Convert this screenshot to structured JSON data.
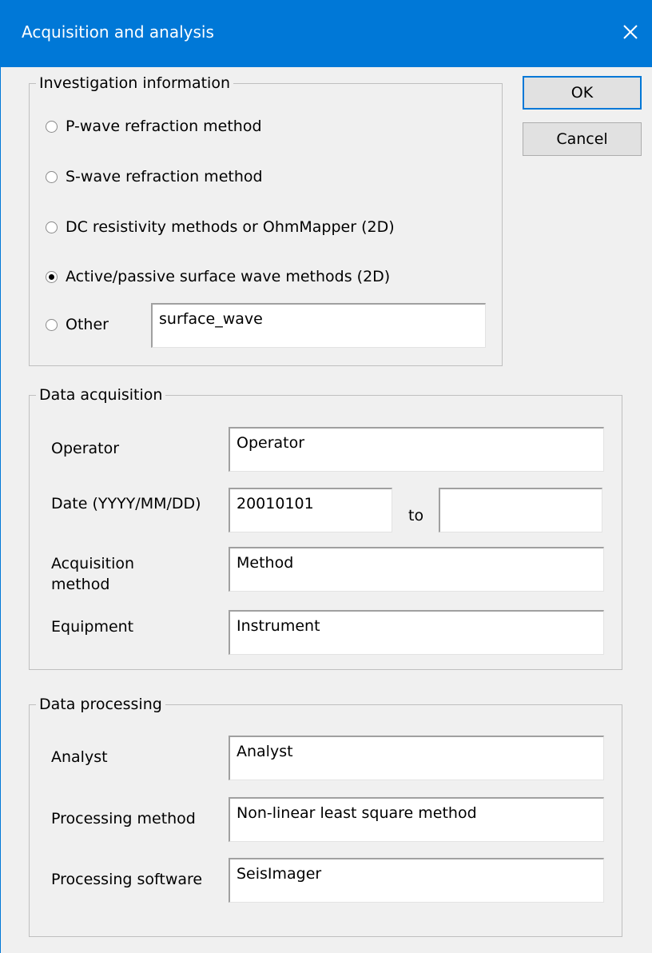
{
  "window": {
    "title": "Acquisition and analysis",
    "close_icon": "close-icon"
  },
  "buttons": {
    "ok": "OK",
    "cancel": "Cancel"
  },
  "investigation": {
    "legend": "Investigation information",
    "options": [
      {
        "label": "P-wave refraction method",
        "checked": false
      },
      {
        "label": "S-wave refraction method",
        "checked": false
      },
      {
        "label": "DC resistivity methods or OhmMapper (2D)",
        "checked": false
      },
      {
        "label": "Active/passive surface wave methods (2D)",
        "checked": true
      },
      {
        "label": "Other",
        "checked": false
      }
    ],
    "other_value": "surface_wave"
  },
  "acquisition": {
    "legend": "Data acquisition",
    "operator_label": "Operator",
    "operator_value": "Operator",
    "date_label": "Date (YYYY/MM/DD)",
    "date_from": "20010101",
    "to_label": "to",
    "date_to": "",
    "method_label_line1": "Acquisition",
    "method_label_line2": "method",
    "method_value": "Method",
    "equipment_label": "Equipment",
    "equipment_value": "Instrument"
  },
  "processing": {
    "legend": "Data processing",
    "analyst_label": "Analyst",
    "analyst_value": "Analyst",
    "method_label": "Processing method",
    "method_value": "Non-linear least square method",
    "software_label": "Processing software",
    "software_value": "SeisImager"
  }
}
